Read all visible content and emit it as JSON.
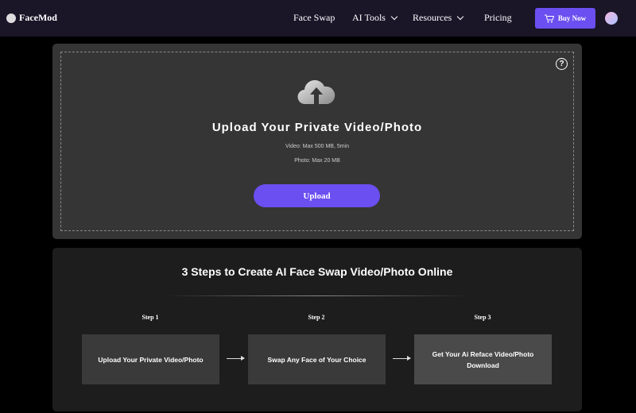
{
  "nav": {
    "brand": "FaceMod",
    "items": [
      {
        "label": "Face Swap"
      },
      {
        "label": "AI Tools"
      },
      {
        "label": "Resources"
      },
      {
        "label": "Pricing"
      }
    ],
    "buy_label": "Buy Now",
    "accent": "#6b4ff0"
  },
  "upload": {
    "help_icon": "?",
    "title": "Upload Your Private Video/Photo",
    "video_limit": "Video: Max 500 MB, 5min",
    "photo_limit": "Photo: Max 20 MB",
    "button_label": "Upload"
  },
  "steps": {
    "title": "3 Steps to Create AI Face Swap Video/Photo Online",
    "items": [
      {
        "label": "Step 1",
        "text": "Upload Your Private Video/Photo"
      },
      {
        "label": "Step 2",
        "text": "Swap Any Face of Your Choice"
      },
      {
        "label": "Step 3",
        "text": "Get Your Ai Reface Video/Photo Download"
      }
    ]
  }
}
